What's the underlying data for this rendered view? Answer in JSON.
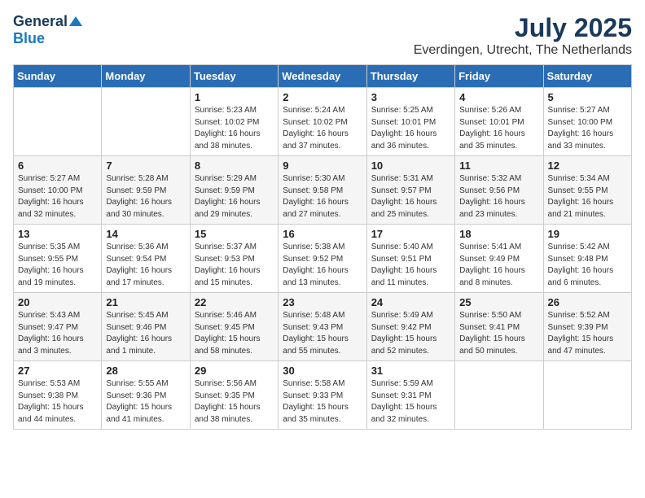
{
  "header": {
    "logo_general": "General",
    "logo_blue": "Blue",
    "month": "July 2025",
    "location": "Everdingen, Utrecht, The Netherlands"
  },
  "days_of_week": [
    "Sunday",
    "Monday",
    "Tuesday",
    "Wednesday",
    "Thursday",
    "Friday",
    "Saturday"
  ],
  "weeks": [
    [
      {
        "day": "",
        "info": ""
      },
      {
        "day": "",
        "info": ""
      },
      {
        "day": "1",
        "info": "Sunrise: 5:23 AM\nSunset: 10:02 PM\nDaylight: 16 hours\nand 38 minutes."
      },
      {
        "day": "2",
        "info": "Sunrise: 5:24 AM\nSunset: 10:02 PM\nDaylight: 16 hours\nand 37 minutes."
      },
      {
        "day": "3",
        "info": "Sunrise: 5:25 AM\nSunset: 10:01 PM\nDaylight: 16 hours\nand 36 minutes."
      },
      {
        "day": "4",
        "info": "Sunrise: 5:26 AM\nSunset: 10:01 PM\nDaylight: 16 hours\nand 35 minutes."
      },
      {
        "day": "5",
        "info": "Sunrise: 5:27 AM\nSunset: 10:00 PM\nDaylight: 16 hours\nand 33 minutes."
      }
    ],
    [
      {
        "day": "6",
        "info": "Sunrise: 5:27 AM\nSunset: 10:00 PM\nDaylight: 16 hours\nand 32 minutes."
      },
      {
        "day": "7",
        "info": "Sunrise: 5:28 AM\nSunset: 9:59 PM\nDaylight: 16 hours\nand 30 minutes."
      },
      {
        "day": "8",
        "info": "Sunrise: 5:29 AM\nSunset: 9:59 PM\nDaylight: 16 hours\nand 29 minutes."
      },
      {
        "day": "9",
        "info": "Sunrise: 5:30 AM\nSunset: 9:58 PM\nDaylight: 16 hours\nand 27 minutes."
      },
      {
        "day": "10",
        "info": "Sunrise: 5:31 AM\nSunset: 9:57 PM\nDaylight: 16 hours\nand 25 minutes."
      },
      {
        "day": "11",
        "info": "Sunrise: 5:32 AM\nSunset: 9:56 PM\nDaylight: 16 hours\nand 23 minutes."
      },
      {
        "day": "12",
        "info": "Sunrise: 5:34 AM\nSunset: 9:55 PM\nDaylight: 16 hours\nand 21 minutes."
      }
    ],
    [
      {
        "day": "13",
        "info": "Sunrise: 5:35 AM\nSunset: 9:55 PM\nDaylight: 16 hours\nand 19 minutes."
      },
      {
        "day": "14",
        "info": "Sunrise: 5:36 AM\nSunset: 9:54 PM\nDaylight: 16 hours\nand 17 minutes."
      },
      {
        "day": "15",
        "info": "Sunrise: 5:37 AM\nSunset: 9:53 PM\nDaylight: 16 hours\nand 15 minutes."
      },
      {
        "day": "16",
        "info": "Sunrise: 5:38 AM\nSunset: 9:52 PM\nDaylight: 16 hours\nand 13 minutes."
      },
      {
        "day": "17",
        "info": "Sunrise: 5:40 AM\nSunset: 9:51 PM\nDaylight: 16 hours\nand 11 minutes."
      },
      {
        "day": "18",
        "info": "Sunrise: 5:41 AM\nSunset: 9:49 PM\nDaylight: 16 hours\nand 8 minutes."
      },
      {
        "day": "19",
        "info": "Sunrise: 5:42 AM\nSunset: 9:48 PM\nDaylight: 16 hours\nand 6 minutes."
      }
    ],
    [
      {
        "day": "20",
        "info": "Sunrise: 5:43 AM\nSunset: 9:47 PM\nDaylight: 16 hours\nand 3 minutes."
      },
      {
        "day": "21",
        "info": "Sunrise: 5:45 AM\nSunset: 9:46 PM\nDaylight: 16 hours\nand 1 minute."
      },
      {
        "day": "22",
        "info": "Sunrise: 5:46 AM\nSunset: 9:45 PM\nDaylight: 15 hours\nand 58 minutes."
      },
      {
        "day": "23",
        "info": "Sunrise: 5:48 AM\nSunset: 9:43 PM\nDaylight: 15 hours\nand 55 minutes."
      },
      {
        "day": "24",
        "info": "Sunrise: 5:49 AM\nSunset: 9:42 PM\nDaylight: 15 hours\nand 52 minutes."
      },
      {
        "day": "25",
        "info": "Sunrise: 5:50 AM\nSunset: 9:41 PM\nDaylight: 15 hours\nand 50 minutes."
      },
      {
        "day": "26",
        "info": "Sunrise: 5:52 AM\nSunset: 9:39 PM\nDaylight: 15 hours\nand 47 minutes."
      }
    ],
    [
      {
        "day": "27",
        "info": "Sunrise: 5:53 AM\nSunset: 9:38 PM\nDaylight: 15 hours\nand 44 minutes."
      },
      {
        "day": "28",
        "info": "Sunrise: 5:55 AM\nSunset: 9:36 PM\nDaylight: 15 hours\nand 41 minutes."
      },
      {
        "day": "29",
        "info": "Sunrise: 5:56 AM\nSunset: 9:35 PM\nDaylight: 15 hours\nand 38 minutes."
      },
      {
        "day": "30",
        "info": "Sunrise: 5:58 AM\nSunset: 9:33 PM\nDaylight: 15 hours\nand 35 minutes."
      },
      {
        "day": "31",
        "info": "Sunrise: 5:59 AM\nSunset: 9:31 PM\nDaylight: 15 hours\nand 32 minutes."
      },
      {
        "day": "",
        "info": ""
      },
      {
        "day": "",
        "info": ""
      }
    ]
  ]
}
